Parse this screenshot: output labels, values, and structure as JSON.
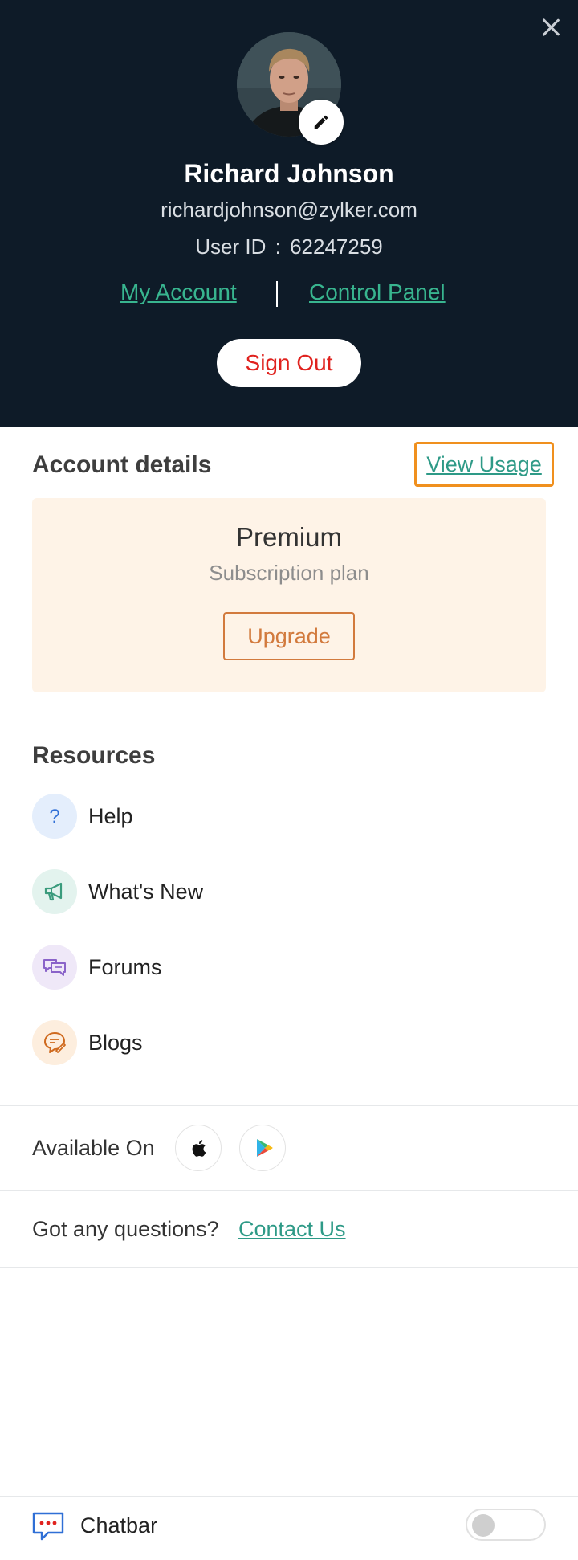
{
  "profile": {
    "name": "Richard Johnson",
    "email": "richardjohnson@zylker.com",
    "user_id_label": "User ID",
    "user_id_sep": ":",
    "user_id": "62247259",
    "my_account_label": "My Account",
    "control_panel_label": "Control Panel",
    "sign_out_label": "Sign Out"
  },
  "account": {
    "title": "Account details",
    "view_usage_label": "View Usage",
    "plan_name": "Premium",
    "plan_subtitle": "Subscription plan",
    "upgrade_label": "Upgrade"
  },
  "resources": {
    "title": "Resources",
    "items": [
      {
        "label": "Help",
        "icon": "help-icon",
        "bg": "#e4eefc",
        "color": "#2f6fd6"
      },
      {
        "label": "What's New",
        "icon": "megaphone-icon",
        "bg": "#e3f3ee",
        "color": "#3a9b7c"
      },
      {
        "label": "Forums",
        "icon": "forums-icon",
        "bg": "#efe8f8",
        "color": "#8a63c9"
      },
      {
        "label": "Blogs",
        "icon": "blogs-icon",
        "bg": "#fdeede",
        "color": "#cf6a1e"
      }
    ]
  },
  "available": {
    "label": "Available On",
    "stores": [
      "apple-store-icon",
      "google-play-icon"
    ]
  },
  "questions": {
    "label": "Got any questions?",
    "contact_label": "Contact Us"
  },
  "chatbar": {
    "label": "Chatbar",
    "enabled": false
  },
  "colors": {
    "header_bg": "#0e1b28",
    "accent_link": "#38b58f",
    "sign_out_text": "#e0221e",
    "plan_card_bg": "#fef3e7",
    "upgrade_accent": "#d27a3d",
    "focus_outline": "#f0901e"
  }
}
